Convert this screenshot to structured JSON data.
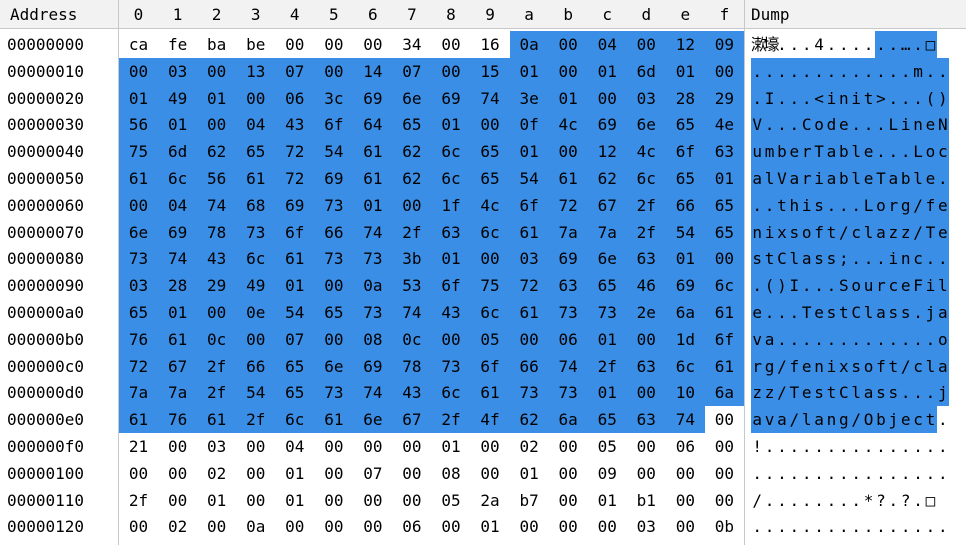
{
  "header": {
    "address_label": "Address",
    "dump_label": "Dump",
    "columns": [
      "0",
      "1",
      "2",
      "3",
      "4",
      "5",
      "6",
      "7",
      "8",
      "9",
      "a",
      "b",
      "c",
      "d",
      "e",
      "f"
    ]
  },
  "colors": {
    "selection": "#3a8ee6",
    "header_bg": "#f2f2f2",
    "grid": "#c8c8c8"
  },
  "rows": [
    {
      "addr": "00000000",
      "bytes": [
        "ca",
        "fe",
        "ba",
        "be",
        "00",
        "00",
        "00",
        "34",
        "00",
        "16",
        "0a",
        "00",
        "04",
        "00",
        "12",
        "09"
      ],
      "dump": "漱壕...4......….□"
    },
    {
      "addr": "00000010",
      "bytes": [
        "00",
        "03",
        "00",
        "13",
        "07",
        "00",
        "14",
        "07",
        "00",
        "15",
        "01",
        "00",
        "01",
        "6d",
        "01",
        "00"
      ],
      "dump": ".............m.."
    },
    {
      "addr": "00000020",
      "bytes": [
        "01",
        "49",
        "01",
        "00",
        "06",
        "3c",
        "69",
        "6e",
        "69",
        "74",
        "3e",
        "01",
        "00",
        "03",
        "28",
        "29"
      ],
      "dump": ".I...<init>...()"
    },
    {
      "addr": "00000030",
      "bytes": [
        "56",
        "01",
        "00",
        "04",
        "43",
        "6f",
        "64",
        "65",
        "01",
        "00",
        "0f",
        "4c",
        "69",
        "6e",
        "65",
        "4e"
      ],
      "dump": "V...Code...LineN"
    },
    {
      "addr": "00000040",
      "bytes": [
        "75",
        "6d",
        "62",
        "65",
        "72",
        "54",
        "61",
        "62",
        "6c",
        "65",
        "01",
        "00",
        "12",
        "4c",
        "6f",
        "63"
      ],
      "dump": "umberTable...Loc"
    },
    {
      "addr": "00000050",
      "bytes": [
        "61",
        "6c",
        "56",
        "61",
        "72",
        "69",
        "61",
        "62",
        "6c",
        "65",
        "54",
        "61",
        "62",
        "6c",
        "65",
        "01"
      ],
      "dump": "alVariableTable."
    },
    {
      "addr": "00000060",
      "bytes": [
        "00",
        "04",
        "74",
        "68",
        "69",
        "73",
        "01",
        "00",
        "1f",
        "4c",
        "6f",
        "72",
        "67",
        "2f",
        "66",
        "65"
      ],
      "dump": "..this...Lorg/fe"
    },
    {
      "addr": "00000070",
      "bytes": [
        "6e",
        "69",
        "78",
        "73",
        "6f",
        "66",
        "74",
        "2f",
        "63",
        "6c",
        "61",
        "7a",
        "7a",
        "2f",
        "54",
        "65"
      ],
      "dump": "nixsoft/clazz/Te"
    },
    {
      "addr": "00000080",
      "bytes": [
        "73",
        "74",
        "43",
        "6c",
        "61",
        "73",
        "73",
        "3b",
        "01",
        "00",
        "03",
        "69",
        "6e",
        "63",
        "01",
        "00"
      ],
      "dump": "stClass;...inc.."
    },
    {
      "addr": "00000090",
      "bytes": [
        "03",
        "28",
        "29",
        "49",
        "01",
        "00",
        "0a",
        "53",
        "6f",
        "75",
        "72",
        "63",
        "65",
        "46",
        "69",
        "6c"
      ],
      "dump": ".()I...SourceFil"
    },
    {
      "addr": "000000a0",
      "bytes": [
        "65",
        "01",
        "00",
        "0e",
        "54",
        "65",
        "73",
        "74",
        "43",
        "6c",
        "61",
        "73",
        "73",
        "2e",
        "6a",
        "61"
      ],
      "dump": "e...TestClass.ja"
    },
    {
      "addr": "000000b0",
      "bytes": [
        "76",
        "61",
        "0c",
        "00",
        "07",
        "00",
        "08",
        "0c",
        "00",
        "05",
        "00",
        "06",
        "01",
        "00",
        "1d",
        "6f"
      ],
      "dump": "va.............o"
    },
    {
      "addr": "000000c0",
      "bytes": [
        "72",
        "67",
        "2f",
        "66",
        "65",
        "6e",
        "69",
        "78",
        "73",
        "6f",
        "66",
        "74",
        "2f",
        "63",
        "6c",
        "61"
      ],
      "dump": "rg/fenixsoft/cla"
    },
    {
      "addr": "000000d0",
      "bytes": [
        "7a",
        "7a",
        "2f",
        "54",
        "65",
        "73",
        "74",
        "43",
        "6c",
        "61",
        "73",
        "73",
        "01",
        "00",
        "10",
        "6a"
      ],
      "dump": "zz/TestClass...j"
    },
    {
      "addr": "000000e0",
      "bytes": [
        "61",
        "76",
        "61",
        "2f",
        "6c",
        "61",
        "6e",
        "67",
        "2f",
        "4f",
        "62",
        "6a",
        "65",
        "63",
        "74",
        "00"
      ],
      "dump": "ava/lang/Object."
    },
    {
      "addr": "000000f0",
      "bytes": [
        "21",
        "00",
        "03",
        "00",
        "04",
        "00",
        "00",
        "00",
        "01",
        "00",
        "02",
        "00",
        "05",
        "00",
        "06",
        "00"
      ],
      "dump": "!..............."
    },
    {
      "addr": "00000100",
      "bytes": [
        "00",
        "00",
        "02",
        "00",
        "01",
        "00",
        "07",
        "00",
        "08",
        "00",
        "01",
        "00",
        "09",
        "00",
        "00",
        "00"
      ],
      "dump": "................"
    },
    {
      "addr": "00000110",
      "bytes": [
        "2f",
        "00",
        "01",
        "00",
        "01",
        "00",
        "00",
        "00",
        "05",
        "2a",
        "b7",
        "00",
        "01",
        "b1",
        "00",
        "00"
      ],
      "dump": "/........*?.?.□"
    },
    {
      "addr": "00000120",
      "bytes": [
        "00",
        "02",
        "00",
        "0a",
        "00",
        "00",
        "00",
        "06",
        "00",
        "01",
        "00",
        "00",
        "00",
        "03",
        "00",
        "0b"
      ],
      "dump": "................"
    }
  ]
}
